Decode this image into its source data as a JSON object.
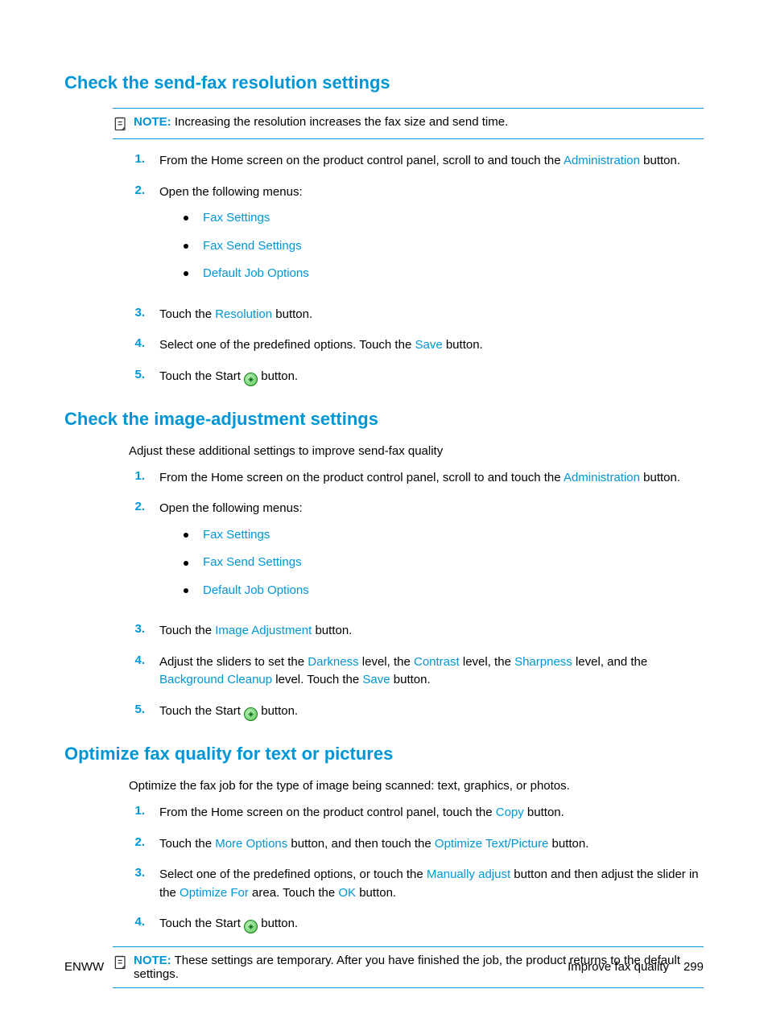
{
  "sections": [
    {
      "heading": "Check the send-fax resolution settings",
      "note": {
        "label": "NOTE:",
        "text": "Increasing the resolution increases the fax size and send time."
      },
      "steps": [
        {
          "num": "1.",
          "parts": [
            {
              "t": "From the Home screen on the product control panel, scroll to and touch the "
            },
            {
              "t": "Administration",
              "ui": true
            },
            {
              "t": " button."
            }
          ]
        },
        {
          "num": "2.",
          "parts": [
            {
              "t": "Open the following menus:"
            }
          ],
          "sub": [
            "Fax Settings",
            "Fax Send Settings",
            "Default Job Options"
          ]
        },
        {
          "num": "3.",
          "parts": [
            {
              "t": "Touch the "
            },
            {
              "t": "Resolution",
              "ui": true
            },
            {
              "t": " button."
            }
          ]
        },
        {
          "num": "4.",
          "parts": [
            {
              "t": "Select one of the predefined options. Touch the "
            },
            {
              "t": "Save",
              "ui": true
            },
            {
              "t": " button."
            }
          ]
        },
        {
          "num": "5.",
          "parts": [
            {
              "t": "Touch the Start "
            },
            {
              "icon": "start"
            },
            {
              "t": " button."
            }
          ]
        }
      ]
    },
    {
      "heading": "Check the image-adjustment settings",
      "intro": "Adjust these additional settings to improve send-fax quality",
      "steps": [
        {
          "num": "1.",
          "parts": [
            {
              "t": "From the Home screen on the product control panel, scroll to and touch the "
            },
            {
              "t": "Administration",
              "ui": true
            },
            {
              "t": " button."
            }
          ]
        },
        {
          "num": "2.",
          "parts": [
            {
              "t": "Open the following menus:"
            }
          ],
          "sub": [
            "Fax Settings",
            "Fax Send Settings",
            "Default Job Options"
          ]
        },
        {
          "num": "3.",
          "parts": [
            {
              "t": "Touch the "
            },
            {
              "t": "Image Adjustment",
              "ui": true
            },
            {
              "t": " button."
            }
          ]
        },
        {
          "num": "4.",
          "parts": [
            {
              "t": "Adjust the sliders to set the "
            },
            {
              "t": "Darkness",
              "ui": true
            },
            {
              "t": " level, the "
            },
            {
              "t": "Contrast",
              "ui": true
            },
            {
              "t": " level, the "
            },
            {
              "t": "Sharpness",
              "ui": true
            },
            {
              "t": " level, and the "
            },
            {
              "t": "Background Cleanup",
              "ui": true
            },
            {
              "t": " level. Touch the "
            },
            {
              "t": "Save",
              "ui": true
            },
            {
              "t": " button."
            }
          ]
        },
        {
          "num": "5.",
          "parts": [
            {
              "t": "Touch the Start "
            },
            {
              "icon": "start"
            },
            {
              "t": " button."
            }
          ]
        }
      ]
    },
    {
      "heading": "Optimize fax quality for text or pictures",
      "intro": "Optimize the fax job for the type of image being scanned: text, graphics, or photos.",
      "steps": [
        {
          "num": "1.",
          "parts": [
            {
              "t": "From the Home screen on the product control panel, touch the "
            },
            {
              "t": "Copy",
              "ui": true
            },
            {
              "t": " button."
            }
          ]
        },
        {
          "num": "2.",
          "parts": [
            {
              "t": "Touch the "
            },
            {
              "t": "More Options",
              "ui": true
            },
            {
              "t": " button, and then touch the "
            },
            {
              "t": "Optimize Text/Picture",
              "ui": true
            },
            {
              "t": " button."
            }
          ]
        },
        {
          "num": "3.",
          "parts": [
            {
              "t": "Select one of the predefined options, or touch the "
            },
            {
              "t": "Manually adjust",
              "ui": true
            },
            {
              "t": " button and then adjust the slider in the "
            },
            {
              "t": "Optimize For",
              "ui": true
            },
            {
              "t": " area. Touch the "
            },
            {
              "t": "OK",
              "ui": true
            },
            {
              "t": " button."
            }
          ]
        },
        {
          "num": "4.",
          "parts": [
            {
              "t": "Touch the Start "
            },
            {
              "icon": "start"
            },
            {
              "t": " button."
            }
          ]
        }
      ],
      "noteAfter": {
        "label": "NOTE:",
        "text": "These settings are temporary. After you have finished the job, the product returns to the default settings."
      }
    }
  ],
  "footer": {
    "left": "ENWW",
    "rightLabel": "Improve fax quality",
    "page": "299"
  }
}
